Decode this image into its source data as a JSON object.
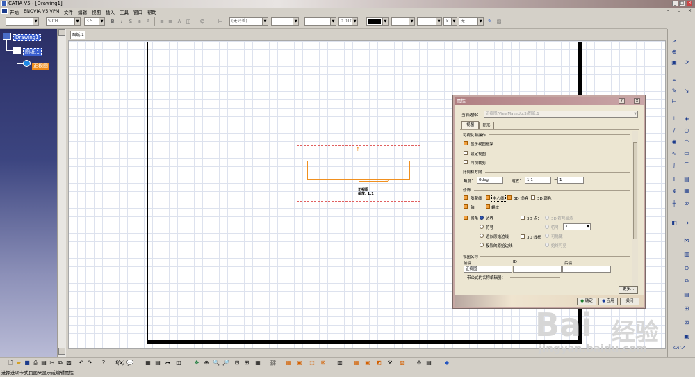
{
  "window": {
    "title": "CATIA V5 - [Drawing1]",
    "buttons": [
      "_",
      "□",
      "×"
    ]
  },
  "menu": [
    "开始",
    "ENOVIA V5 VPM",
    "文件",
    "编辑",
    "视图",
    "插入",
    "工具",
    "窗口",
    "帮助"
  ],
  "format_toolbar": {
    "font_name": "SICH",
    "font_size": "3.5",
    "tolerance": "(无公差)",
    "precision": "0.010",
    "fill": "无"
  },
  "tree": {
    "root": "Drawing1",
    "sheet": "图纸.1",
    "view": "正视图"
  },
  "sheet_tab": "图纸.1",
  "drawing": {
    "view_label": "正视图",
    "scale_label": "缩放: 1:1"
  },
  "dialog": {
    "title": "属性",
    "current_selection_label": "当前选择：",
    "current_selection_value": "正视图/ViewMakeUp.3/图纸.1",
    "tabs": [
      "视图",
      "图形"
    ],
    "visualization_section": "可视化和操作",
    "show_view_frame": "显示视图框架",
    "lock_view": "锁定视图",
    "visual_clipping": "可视裁剪",
    "scale_section": "比例和方向",
    "angle_label": "角度：",
    "angle_value": "0deg",
    "scale_label": "缩放：",
    "scale_value": "1:1",
    "scale_sep": "=",
    "scale_value2": "1",
    "dress_section": "修饰",
    "hidden_lines": "隐藏线",
    "center_lines": "中心线",
    "threed_spec": "3D 规格",
    "threed_colors": "3D 颜色",
    "axis": "轴",
    "thread": "螺纹",
    "fillets": "圆角",
    "boundaries": "边界",
    "threed_points": "3D 点：",
    "threed_spec_inherit": "3D 符号继承",
    "symbol": "符号",
    "symbol2": "符号",
    "symbol_value": "X",
    "approx_original_edges": "近似原始边线",
    "threed_wireframe": "3D 线框",
    "can_hide": "可隐藏",
    "projected_original_edges": "投影的原始边线",
    "always_visible": "始终可见",
    "view_name_section": "视图名称",
    "prefix_label": "前缀",
    "id_label": "ID",
    "suffix_label": "后缀",
    "prefix_value": "正视图",
    "formula_editor": "带公式的名称编辑器：",
    "more_button": "更多...",
    "ok_button": "确定",
    "apply_button": "应用",
    "close_button": "关闭"
  },
  "status_bar": "选择选项卡式页面来显示或编辑属性",
  "watermark": {
    "brand": "Bai",
    "brand2": "经验",
    "url": "jingyan.baidu.com"
  },
  "colors": {
    "tree_bg": "#2b2f66",
    "accent_orange": "#f08a18",
    "view_frame": "#e06060",
    "geometry": "#f09020",
    "dialog_title": "#b07f82"
  }
}
